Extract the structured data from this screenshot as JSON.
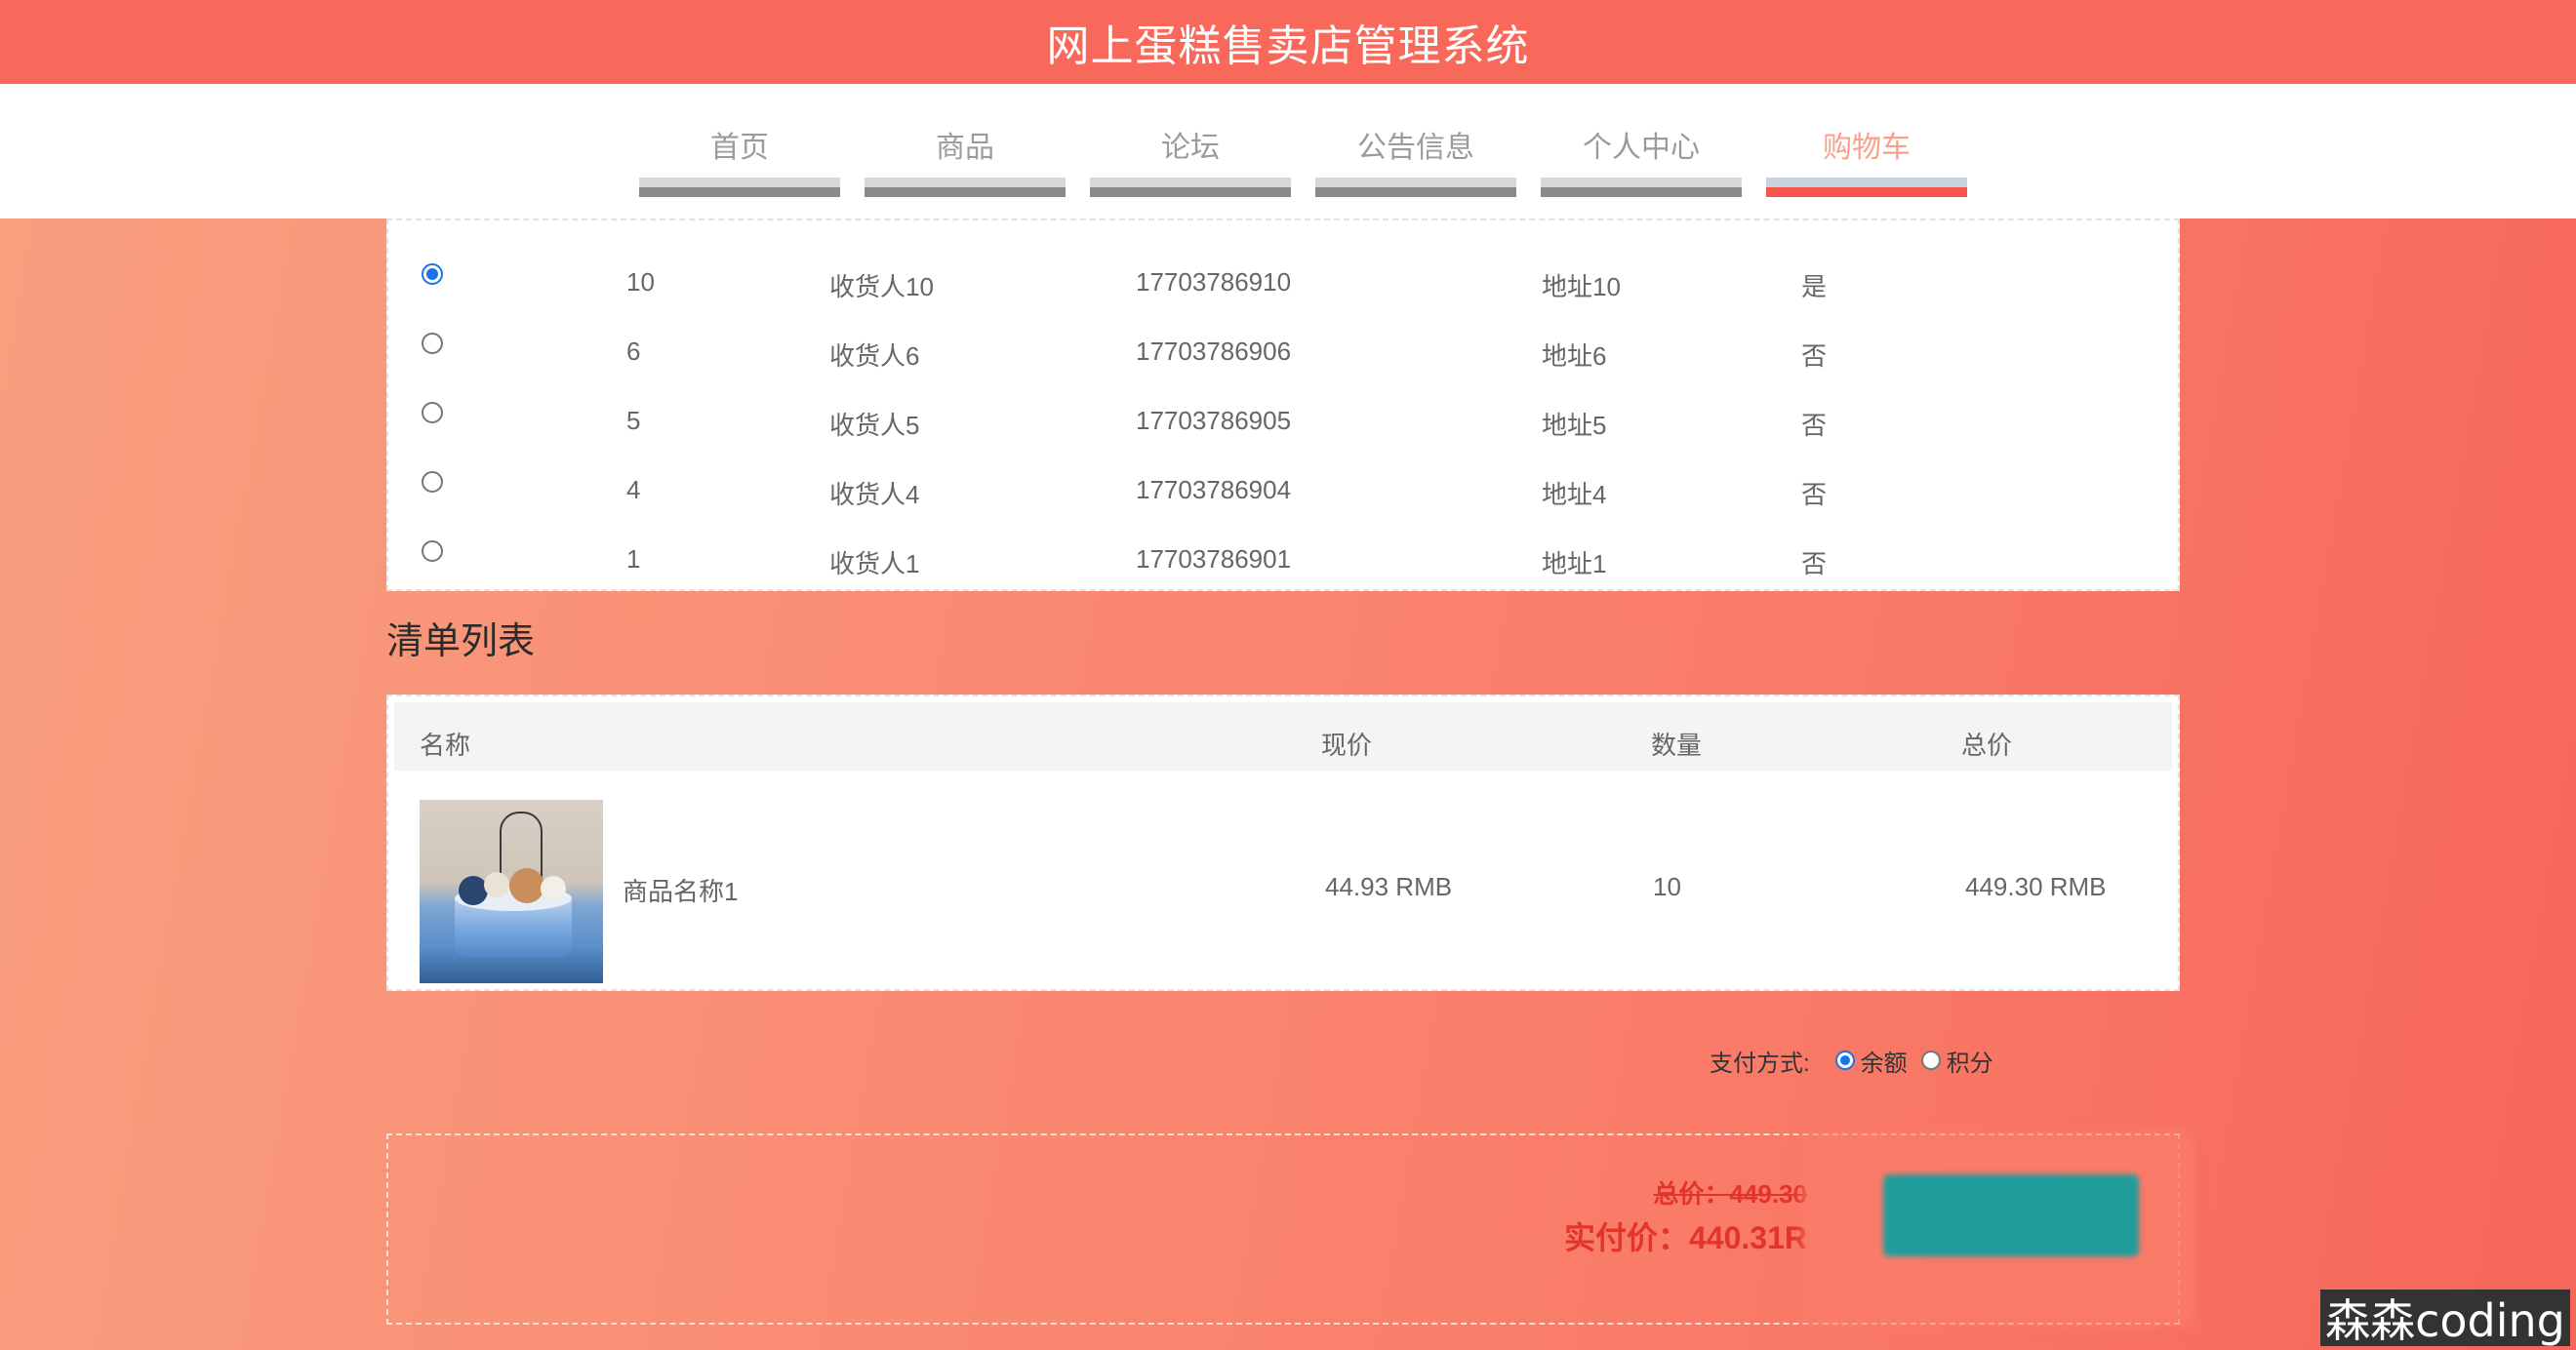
{
  "app": {
    "title": "网上蛋糕售卖店管理系统"
  },
  "nav": {
    "items": [
      {
        "label": "首页"
      },
      {
        "label": "商品"
      },
      {
        "label": "论坛"
      },
      {
        "label": "公告信息"
      },
      {
        "label": "个人中心"
      },
      {
        "label": "购物车"
      }
    ],
    "active_index": 5
  },
  "addresses": [
    {
      "id": "10",
      "name": "收货人10",
      "phone": "17703786910",
      "address": "地址10",
      "is_default": "是",
      "selected": true
    },
    {
      "id": "6",
      "name": "收货人6",
      "phone": "17703786906",
      "address": "地址6",
      "is_default": "否",
      "selected": false
    },
    {
      "id": "5",
      "name": "收货人5",
      "phone": "17703786905",
      "address": "地址5",
      "is_default": "否",
      "selected": false
    },
    {
      "id": "4",
      "name": "收货人4",
      "phone": "17703786904",
      "address": "地址4",
      "is_default": "否",
      "selected": false
    },
    {
      "id": "1",
      "name": "收货人1",
      "phone": "17703786901",
      "address": "地址1",
      "is_default": "否",
      "selected": false
    }
  ],
  "order_list": {
    "title": "清单列表",
    "headers": {
      "name": "名称",
      "price": "现价",
      "quantity": "数量",
      "total": "总价"
    },
    "items": [
      {
        "image": "cake-image",
        "name": "商品名称1",
        "price": "44.93 RMB",
        "quantity": "10",
        "total": "449.30 RMB"
      }
    ]
  },
  "payment": {
    "label": "支付方式:",
    "options": [
      {
        "label": "余额",
        "selected": true
      },
      {
        "label": "积分",
        "selected": false
      }
    ]
  },
  "summary": {
    "original_total": "总价：449.30",
    "actual_total": "实付价：440.31R"
  },
  "watermark": "森森coding",
  "colors": {
    "header_bg": "#f8685b",
    "active_nav": "#f7554a",
    "price_red": "#e3342a",
    "checkout_teal": "#1f9c9c"
  }
}
